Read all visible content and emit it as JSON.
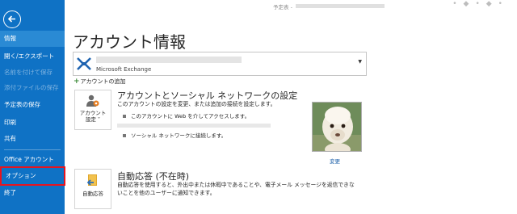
{
  "titlebar": {
    "text": "予定表 - "
  },
  "sidebar": {
    "back_label": "",
    "items": [
      {
        "label": "情報"
      },
      {
        "label": "開く/エクスポート"
      },
      {
        "label": "名前を付けて保存"
      },
      {
        "label": "添付ファイルの保存"
      },
      {
        "label": "予定表の保存"
      },
      {
        "label": "印刷"
      },
      {
        "label": "共有"
      },
      {
        "label": "Office アカウント"
      },
      {
        "label": "オプション"
      },
      {
        "label": "終了"
      }
    ]
  },
  "page": {
    "title": "アカウント情報"
  },
  "account": {
    "type": "Microsoft Exchange",
    "add_label": "アカウントの追加"
  },
  "account_settings": {
    "button_line1": "アカウント",
    "button_line2": "設定 ˅",
    "title": "アカウントとソーシャル ネットワークの設定",
    "desc": "このアカウントの設定を変更、または追加の接続を設定します。",
    "bullet1": "このアカウントに Web を介してアクセスします。",
    "bullet2": "ソーシャル ネットワークに接続します。",
    "change_label": "変更"
  },
  "auto_reply": {
    "button_label": "自動応答",
    "title": "自動応答 (不在時)",
    "desc1": "自動応答を使用すると、外出中または休暇中であることや、電子メール メッセージを返信できな",
    "desc2": "いことを他のユーザーに通知できます。"
  },
  "colors": {
    "sidebar": "#0f72c5",
    "active_item": "#2a8ad4",
    "highlight": "#e8141e"
  }
}
